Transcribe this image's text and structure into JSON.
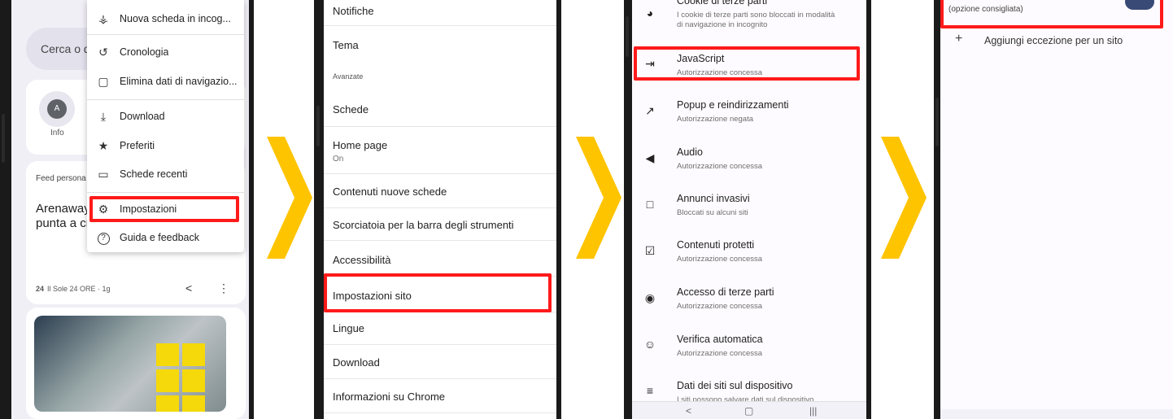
{
  "phone1": {
    "search_placeholder": "Cerca o di",
    "tile_avatar": "A",
    "tile_label": "Info",
    "feed_label": "Feed persona",
    "headline": "Arenaway in pista su Cuneo-Sa punta a crescere negli intercity",
    "source": "Il Sole 24 ORE · 1g",
    "source_icon_text": "24",
    "menu": [
      {
        "icon": "incognito-icon",
        "glyph": "☶",
        "label": "Nuova scheda in incog..."
      },
      {
        "icon": "history-icon",
        "glyph": "↺",
        "label": "Cronologia"
      },
      {
        "icon": "trash-icon",
        "glyph": "☒",
        "label": "Elimina dati di navigazio..."
      },
      {
        "icon": "download-icon",
        "glyph": "⤓",
        "label": "Download"
      },
      {
        "icon": "star-icon",
        "glyph": "★",
        "label": "Preferiti"
      },
      {
        "icon": "devices-icon",
        "glyph": "▭",
        "label": "Schede recenti"
      },
      {
        "icon": "gear-icon",
        "glyph": "⚙",
        "label": "Impostazioni"
      },
      {
        "icon": "help-icon",
        "glyph": "?",
        "label": "Guida e feedback"
      }
    ]
  },
  "phone2": {
    "items": [
      {
        "title": "Notifiche"
      },
      {
        "title": "Tema"
      },
      {
        "section": "Avanzate"
      },
      {
        "title": "Schede"
      },
      {
        "title": "Home page",
        "subtitle": "On"
      },
      {
        "title": "Contenuti nuove schede"
      },
      {
        "title": "Scorciatoia per la barra degli strumenti"
      },
      {
        "title": "Accessibilità"
      },
      {
        "title": "Impostazioni sito"
      },
      {
        "title": "Lingue"
      },
      {
        "title": "Download"
      },
      {
        "title": "Informazioni su Chrome"
      }
    ]
  },
  "phone3": {
    "items": [
      {
        "icon": "cookie-icon",
        "glyph": "◕",
        "title": "Cookie di terze parti",
        "subtitle": "I cookie di terze parti sono bloccati in modalità",
        "subtitle2": "di navigazione in incognito"
      },
      {
        "icon": "javascript-icon",
        "glyph": "⇥",
        "title": "JavaScript",
        "subtitle": "Autorizzazione concessa"
      },
      {
        "icon": "popup-icon",
        "glyph": "↗",
        "title": "Popup e reindirizzamenti",
        "subtitle": "Autorizzazione negata"
      },
      {
        "icon": "audio-icon",
        "glyph": "◀",
        "title": "Audio",
        "subtitle": "Autorizzazione concessa"
      },
      {
        "icon": "ads-icon",
        "glyph": "□",
        "title": "Annunci invasivi",
        "subtitle": "Bloccati su alcuni siti"
      },
      {
        "icon": "protected-content-icon",
        "glyph": "☑",
        "title": "Contenuti protetti",
        "subtitle": "Autorizzazione concessa"
      },
      {
        "icon": "third-party-signin-icon",
        "glyph": "◉",
        "title": "Accesso di terze parti",
        "subtitle": "Autorizzazione concessa"
      },
      {
        "icon": "auto-verify-icon",
        "glyph": "☺",
        "title": "Verifica automatica",
        "subtitle": "Autorizzazione concessa"
      },
      {
        "icon": "database-icon",
        "glyph": "≡",
        "title": "Dati dei siti sul dispositivo",
        "subtitle": "I siti possono salvare dati sul dispositivo"
      }
    ],
    "nav": [
      "<",
      "▢",
      "|||"
    ]
  },
  "phone4": {
    "recommended": "(opzione consigliata)",
    "add_icon": "+",
    "add_exception": "Aggiungi eccezione per un sito"
  },
  "colors": {
    "highlight": "#ff1a1a",
    "chevron": "#ffc400",
    "toggle": "#394a77"
  }
}
